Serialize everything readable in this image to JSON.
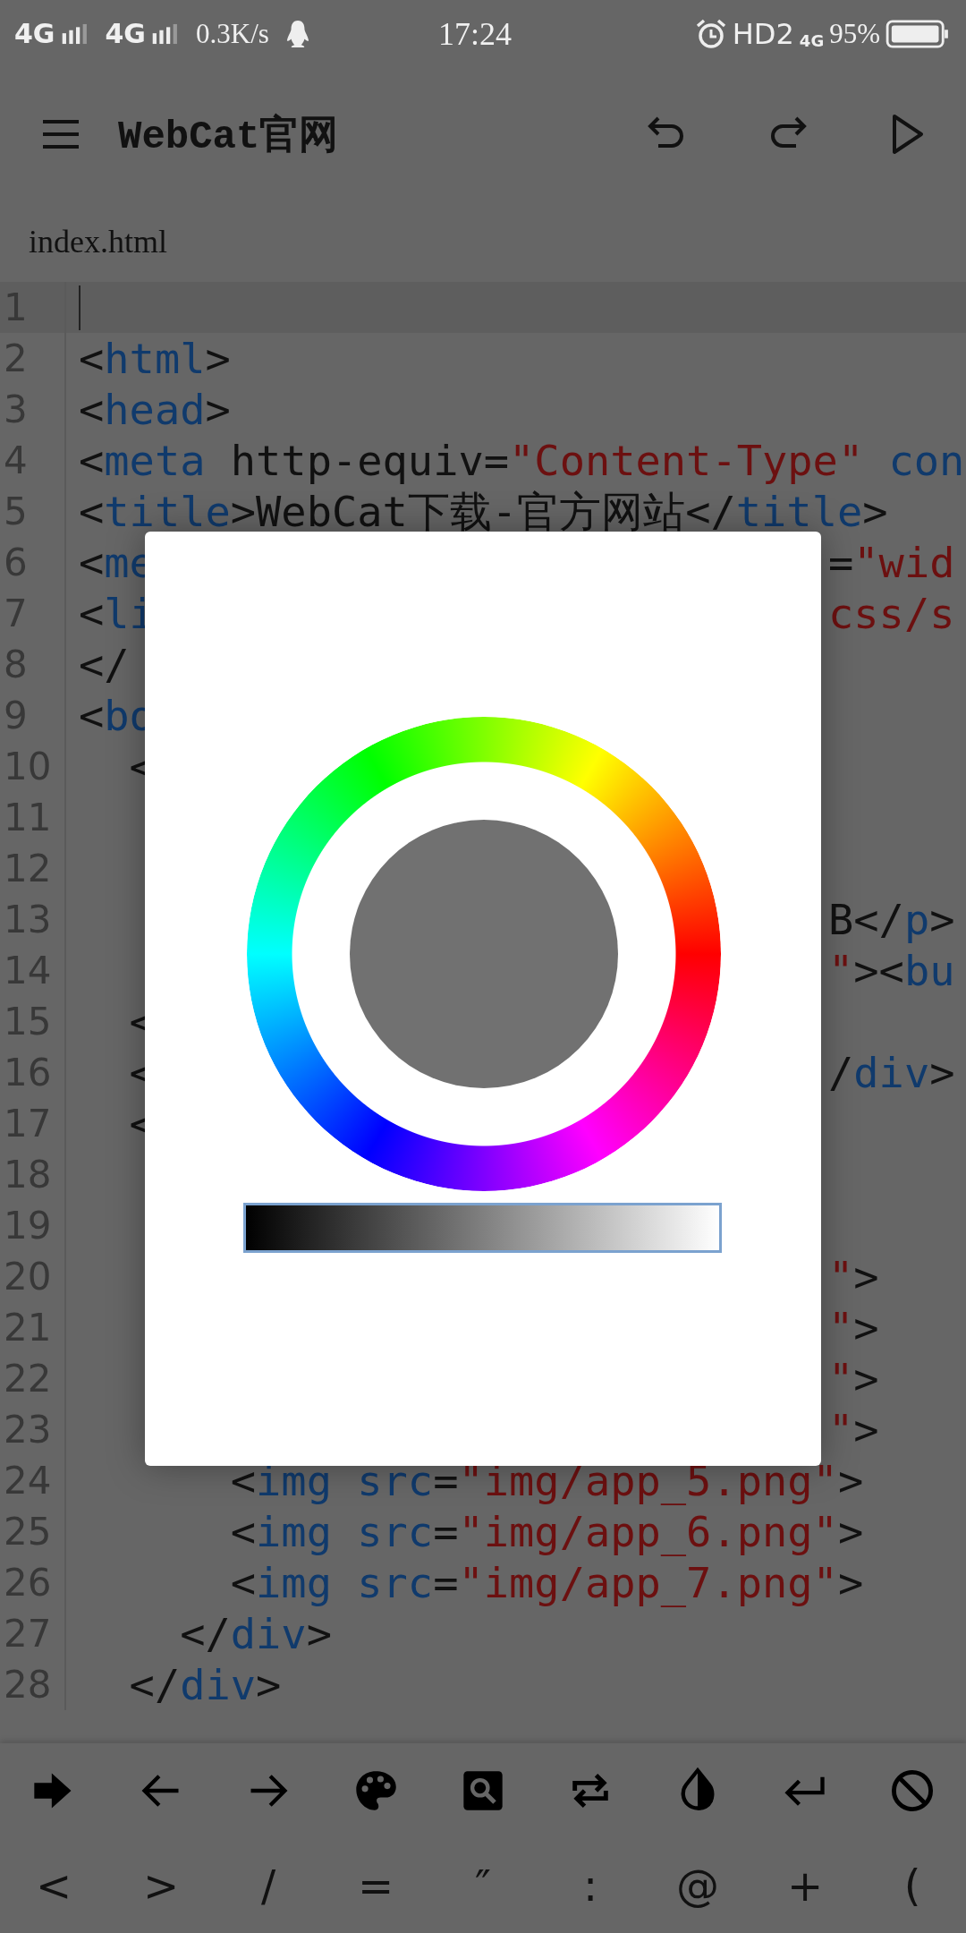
{
  "status_bar": {
    "carriers": [
      "4G",
      "4G"
    ],
    "speed": "0.3K/s",
    "time": "17:24",
    "hd": "HD2",
    "network": "4G",
    "battery": "95%"
  },
  "toolbar": {
    "title": "WebCat官网"
  },
  "file_tab": {
    "label": "index.html"
  },
  "lines": [
    {
      "number": "1",
      "current": true
    },
    {
      "number": "2",
      "current": false,
      "left": [
        {
          "text": "<",
          "kind": "plain"
        },
        {
          "text": "html",
          "kind": "tag"
        },
        {
          "text": ">",
          "kind": "plain"
        }
      ]
    },
    {
      "number": "3",
      "current": false,
      "left": [
        {
          "text": "<",
          "kind": "plain"
        },
        {
          "text": "head",
          "kind": "tag"
        },
        {
          "text": ">",
          "kind": "plain"
        }
      ]
    },
    {
      "number": "4",
      "current": false,
      "left": [
        {
          "text": "<",
          "kind": "plain"
        },
        {
          "text": "meta",
          "kind": "tag"
        },
        {
          "text": " http-equiv=",
          "kind": "plain"
        },
        {
          "text": "\"Content-Type\"",
          "kind": "string"
        },
        {
          "text": " con",
          "kind": "tag"
        }
      ]
    },
    {
      "number": "5",
      "current": false,
      "left": [
        {
          "text": "<",
          "kind": "plain"
        },
        {
          "text": "title",
          "kind": "tag"
        },
        {
          "text": ">WebCat下载-官方网站</",
          "kind": "plain"
        },
        {
          "text": "title",
          "kind": "tag"
        },
        {
          "text": ">",
          "kind": "plain"
        }
      ]
    },
    {
      "number": "6",
      "current": false,
      "left": [
        {
          "text": "<",
          "kind": "plain"
        },
        {
          "text": "me",
          "kind": "tag"
        }
      ],
      "right": [
        {
          "text": "=",
          "kind": "plain"
        },
        {
          "text": "\"wid",
          "kind": "string"
        }
      ]
    },
    {
      "number": "7",
      "current": false,
      "left": [
        {
          "text": "<",
          "kind": "plain"
        },
        {
          "text": "li",
          "kind": "tag"
        }
      ],
      "right": [
        {
          "text": "css/s",
          "kind": "string"
        }
      ]
    },
    {
      "number": "8",
      "current": false,
      "left": [
        {
          "text": "</",
          "kind": "plain"
        }
      ]
    },
    {
      "number": "9",
      "current": false,
      "left": [
        {
          "text": "<",
          "kind": "plain"
        },
        {
          "text": "bo",
          "kind": "tag"
        }
      ]
    },
    {
      "number": "10",
      "current": false,
      "left": [
        {
          "text": "  <",
          "kind": "plain"
        }
      ]
    },
    {
      "number": "11",
      "current": false
    },
    {
      "number": "12",
      "current": false
    },
    {
      "number": "13",
      "current": false,
      "right": [
        {
          "text": "B</",
          "kind": "plain"
        },
        {
          "text": "p",
          "kind": "tag"
        },
        {
          "text": ">",
          "kind": "plain"
        }
      ]
    },
    {
      "number": "14",
      "current": false,
      "right": [
        {
          "text": "\"",
          "kind": "string"
        },
        {
          "text": "><",
          "kind": "plain"
        },
        {
          "text": "bu",
          "kind": "tag"
        }
      ]
    },
    {
      "number": "15",
      "current": false,
      "left": [
        {
          "text": "  <",
          "kind": "plain"
        }
      ]
    },
    {
      "number": "16",
      "current": false,
      "left": [
        {
          "text": "  <",
          "kind": "plain"
        }
      ],
      "right": [
        {
          "text": "/",
          "kind": "plain"
        },
        {
          "text": "div",
          "kind": "tag"
        },
        {
          "text": ">",
          "kind": "plain"
        }
      ]
    },
    {
      "number": "17",
      "current": false,
      "left": [
        {
          "text": "  <",
          "kind": "plain"
        }
      ]
    },
    {
      "number": "18",
      "current": false
    },
    {
      "number": "19",
      "current": false
    },
    {
      "number": "20",
      "current": false,
      "right": [
        {
          "text": "\"",
          "kind": "string"
        },
        {
          "text": ">",
          "kind": "plain"
        }
      ]
    },
    {
      "number": "21",
      "current": false,
      "right": [
        {
          "text": "\"",
          "kind": "string"
        },
        {
          "text": ">",
          "kind": "plain"
        }
      ]
    },
    {
      "number": "22",
      "current": false,
      "right": [
        {
          "text": "\"",
          "kind": "string"
        },
        {
          "text": ">",
          "kind": "plain"
        }
      ]
    },
    {
      "number": "23",
      "current": false,
      "right": [
        {
          "text": "\"",
          "kind": "string"
        },
        {
          "text": ">",
          "kind": "plain"
        }
      ]
    },
    {
      "number": "24",
      "current": false,
      "left": [
        {
          "text": "      <",
          "kind": "plain"
        },
        {
          "text": "img src",
          "kind": "tag"
        },
        {
          "text": "=",
          "kind": "plain"
        },
        {
          "text": "\"img/app_5.png\"",
          "kind": "string"
        },
        {
          "text": ">",
          "kind": "plain"
        }
      ]
    },
    {
      "number": "25",
      "current": false,
      "left": [
        {
          "text": "      <",
          "kind": "plain"
        },
        {
          "text": "img src",
          "kind": "tag"
        },
        {
          "text": "=",
          "kind": "plain"
        },
        {
          "text": "\"img/app_6.png\"",
          "kind": "string"
        },
        {
          "text": ">",
          "kind": "plain"
        }
      ]
    },
    {
      "number": "26",
      "current": false,
      "left": [
        {
          "text": "      <",
          "kind": "plain"
        },
        {
          "text": "img src",
          "kind": "tag"
        },
        {
          "text": "=",
          "kind": "plain"
        },
        {
          "text": "\"img/app_7.png\"",
          "kind": "string"
        },
        {
          "text": ">",
          "kind": "plain"
        }
      ]
    },
    {
      "number": "27",
      "current": false,
      "left": [
        {
          "text": "    </",
          "kind": "plain"
        },
        {
          "text": "div",
          "kind": "tag"
        },
        {
          "text": ">",
          "kind": "plain"
        }
      ]
    },
    {
      "number": "28",
      "current": false,
      "left": [
        {
          "text": "  </",
          "kind": "plain"
        },
        {
          "text": "div",
          "kind": "tag"
        },
        {
          "text": ">",
          "kind": "plain"
        }
      ]
    }
  ],
  "keys": {
    "icons": [
      {
        "kind": "indent"
      },
      {
        "kind": "left"
      },
      {
        "kind": "right"
      },
      {
        "kind": "palette"
      },
      {
        "kind": "search"
      },
      {
        "kind": "repeat"
      },
      {
        "kind": "contrast"
      },
      {
        "kind": "return"
      },
      {
        "kind": "block"
      }
    ],
    "symbols": [
      "<",
      ">",
      "/",
      "=",
      "″",
      ":",
      "@",
      "+",
      "("
    ]
  }
}
